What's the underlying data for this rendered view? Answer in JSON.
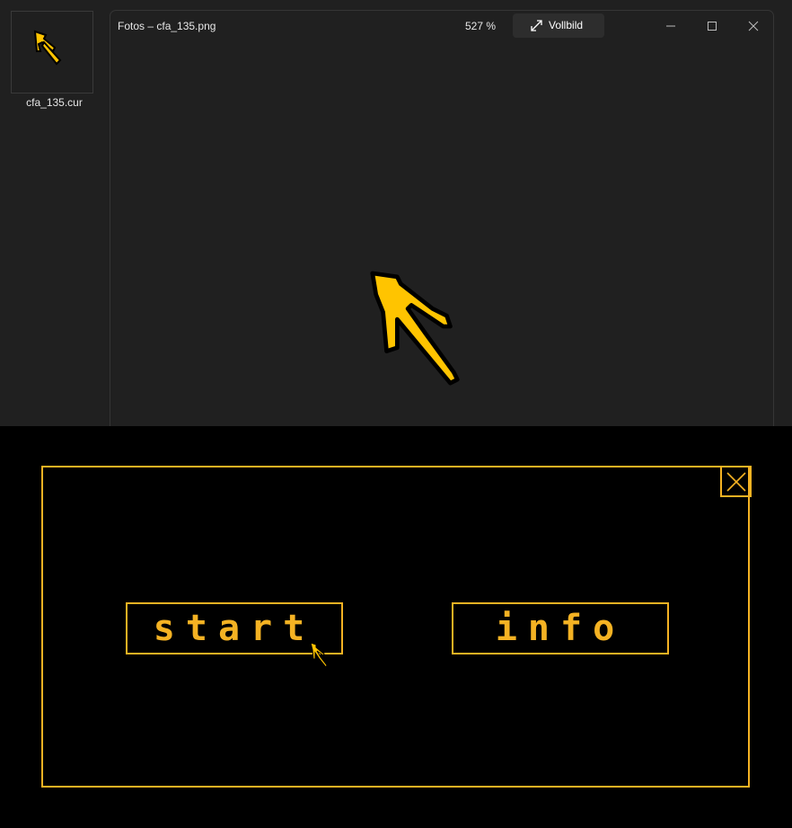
{
  "desktop": {
    "file_name": "cfa_135.cur"
  },
  "photos_window": {
    "title": "Fotos – cfa_135.png",
    "zoom": "527 %",
    "fullscreen_label": "Vollbild"
  },
  "game_menu": {
    "start_label": "start",
    "info_label": "info"
  },
  "colors": {
    "accent": "#f4b223",
    "cursor_yellow": "#ffc400",
    "viewer_bg": "#202020"
  }
}
